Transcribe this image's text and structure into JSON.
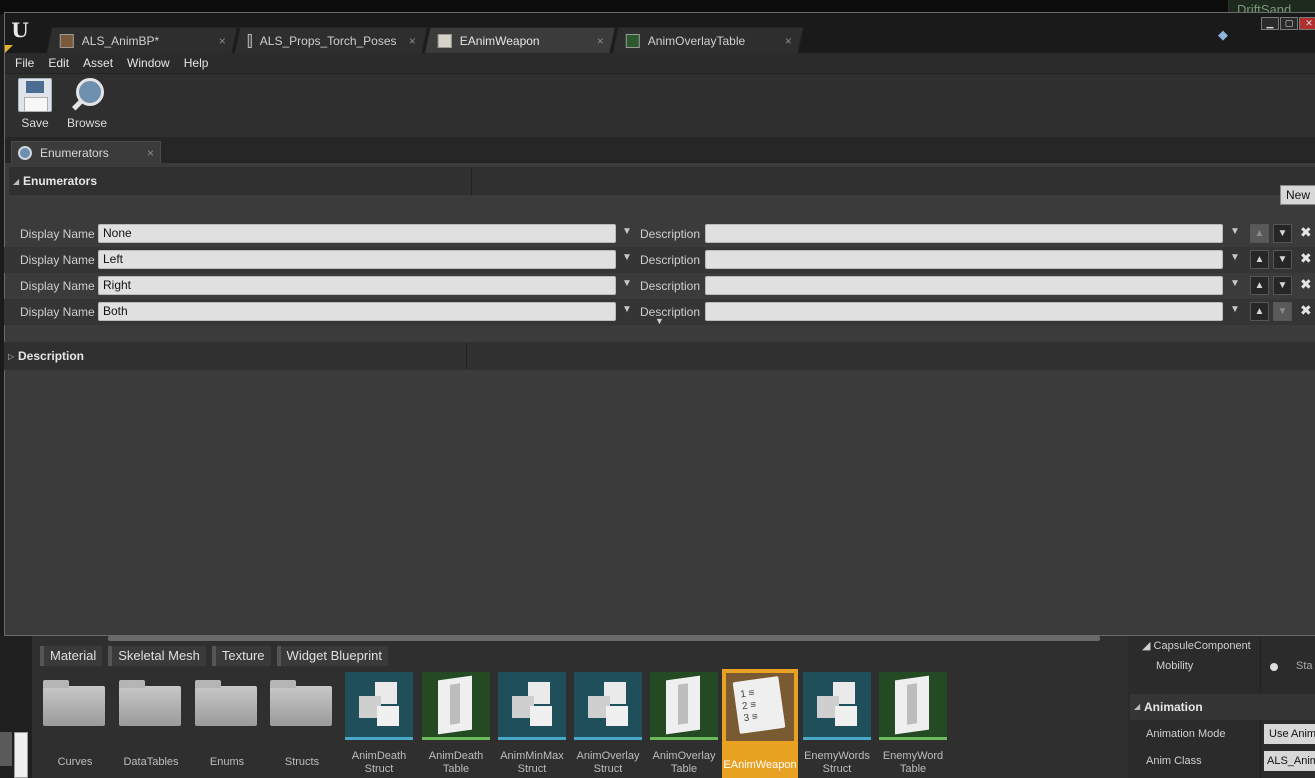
{
  "background": {
    "top_right_text": "DriftSand"
  },
  "window": {
    "tabs": [
      {
        "label": "ALS_AnimBP*",
        "icon": "anim-blueprint-icon",
        "close": "×"
      },
      {
        "label": "ALS_Props_Torch_Poses",
        "icon": "anim-sequence-icon",
        "close": "×"
      },
      {
        "label": "EAnimWeapon",
        "icon": "enum-icon",
        "close": "×"
      },
      {
        "label": "AnimOverlayTable",
        "icon": "data-table-icon",
        "close": "×"
      }
    ],
    "buttons": {
      "minimize": "▁",
      "maximize": "▢",
      "close": "✕"
    }
  },
  "menu": [
    "File",
    "Edit",
    "Asset",
    "Window",
    "Help"
  ],
  "toolbar": {
    "save_label": "Save",
    "browse_label": "Browse"
  },
  "panel": {
    "tab_label": "Enumerators",
    "tab_close": "×"
  },
  "enumerators": {
    "section_title": "Enumerators",
    "new_label": "New",
    "display_name_label": "Display Name",
    "description_label": "Description",
    "rows": [
      {
        "display_name": "None",
        "description": ""
      },
      {
        "display_name": "Left",
        "description": ""
      },
      {
        "display_name": "Right",
        "description": ""
      },
      {
        "display_name": "Both",
        "description": ""
      }
    ]
  },
  "description_section": {
    "title": "Description"
  },
  "content_browser": {
    "filters": [
      "Material",
      "Skeletal Mesh",
      "Texture",
      "Widget Blueprint"
    ],
    "assets": [
      {
        "name": "Curves",
        "type": "folder"
      },
      {
        "name": "DataTables",
        "type": "folder"
      },
      {
        "name": "Enums",
        "type": "folder"
      },
      {
        "name": "Structs",
        "type": "folder"
      },
      {
        "name": "AnimDeath Struct",
        "type": "struct"
      },
      {
        "name": "AnimDeath Table",
        "type": "table"
      },
      {
        "name": "AnimMinMax Struct",
        "type": "struct"
      },
      {
        "name": "AnimOverlay Struct",
        "type": "struct"
      },
      {
        "name": "AnimOverlay Table",
        "type": "table"
      },
      {
        "name": "EAnimWeapon",
        "type": "enum",
        "selected": true
      },
      {
        "name": "EnemyWords Struct",
        "type": "struct"
      },
      {
        "name": "EnemyWord Table",
        "type": "table"
      }
    ]
  },
  "details": {
    "capsule_component": "CapsuleComponent",
    "mobility_label": "Mobility",
    "mobility_value": "Sta",
    "animation_section": "Animation",
    "animation_mode_label": "Animation Mode",
    "animation_mode_value": "Use Anim",
    "anim_class_label": "Anim Class",
    "anim_class_value": "ALS_Anim"
  }
}
